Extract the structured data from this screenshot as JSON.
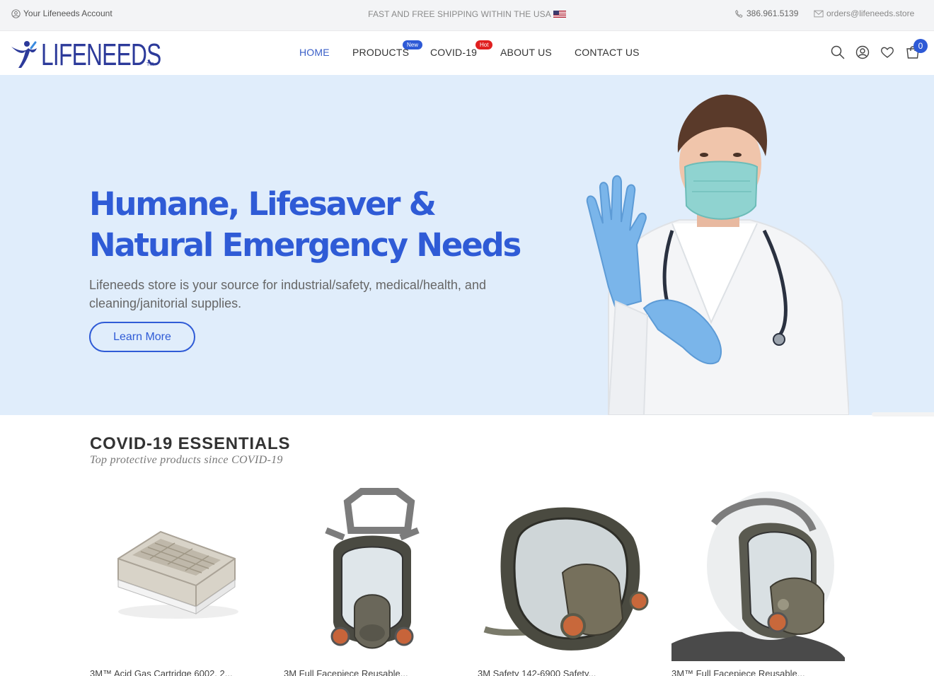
{
  "topbar": {
    "account_label": "Your Lifeneeds Account",
    "shipping_text": "FAST AND FREE SHIPPING WITHIN THE USA",
    "phone": "386.961.5139",
    "email": "orders@lifeneeds.store"
  },
  "brand": {
    "logo_text": "LIFENEEDS",
    "tm": "TM",
    "color": "#2c3a9a"
  },
  "nav": {
    "items": [
      {
        "label": "HOME",
        "active": true
      },
      {
        "label": "PRODUCTS",
        "badge": "New"
      },
      {
        "label": "COVID-19",
        "badge": "Hot"
      },
      {
        "label": "ABOUT US"
      },
      {
        "label": "CONTACT US"
      }
    ],
    "icons": [
      "search-icon",
      "account-icon",
      "heart-icon",
      "cart-icon"
    ],
    "cart_count": "0"
  },
  "hero": {
    "title_line1": "Humane, Lifesaver &",
    "title_line2": "Natural Emergency Needs",
    "description": "Lifeneeds store is your source for industrial/safety, medical/health, and cleaning/janitorial supplies.",
    "cta_label": "Learn More",
    "accent_color": "#2f5bd6",
    "background_color": "#e0edfb"
  },
  "section": {
    "title": "COVID-19 ESSENTIALS",
    "subtitle": "Top protective products since COVID-19"
  },
  "products": [
    {
      "name": "3M™ Acid Gas Cartridge 6002, 2..."
    },
    {
      "name": "3M Full Facepiece Reusable..."
    },
    {
      "name": "3M Safety 142-6900 Safety..."
    },
    {
      "name": "3M™ Full Facepiece Reusable..."
    }
  ]
}
